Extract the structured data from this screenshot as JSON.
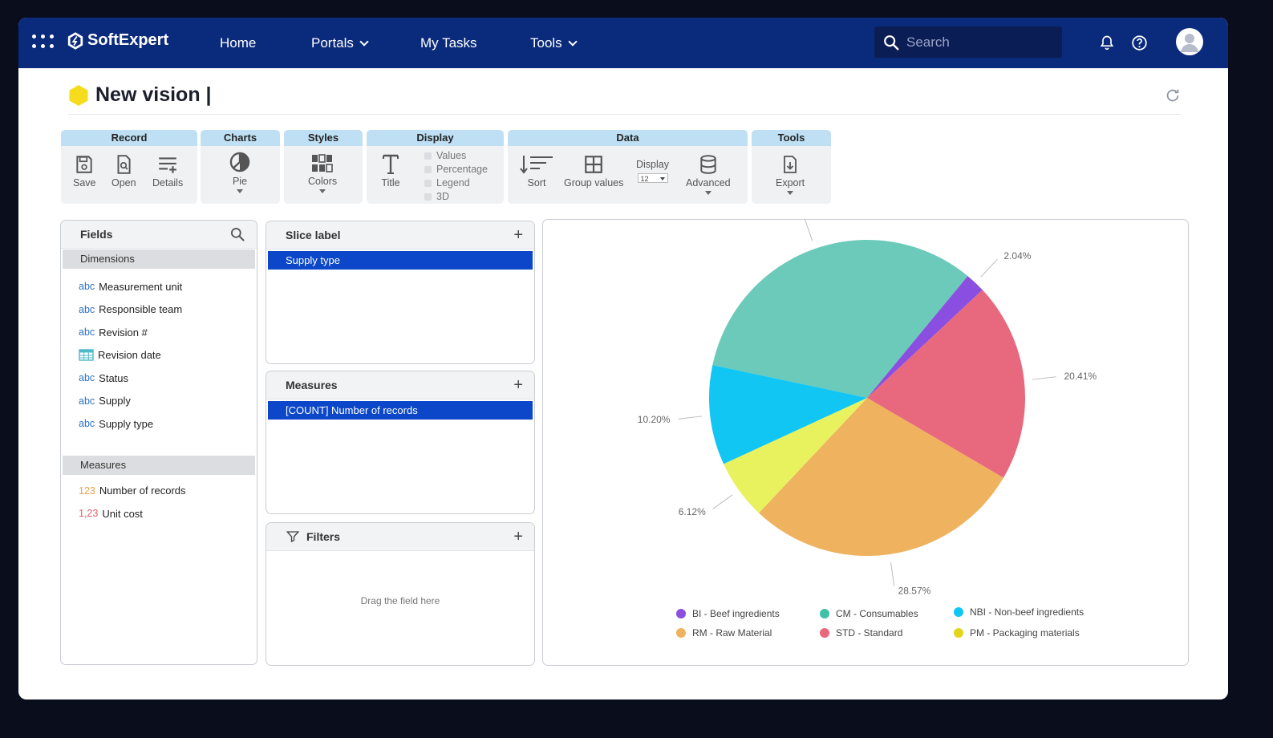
{
  "header": {
    "brand": "SoftExpert",
    "nav": [
      {
        "label": "Home",
        "has_dropdown": false
      },
      {
        "label": "Portals",
        "has_dropdown": true
      },
      {
        "label": "My Tasks",
        "has_dropdown": false
      },
      {
        "label": "Tools",
        "has_dropdown": true
      }
    ],
    "search_placeholder": "Search",
    "icons": [
      "apps-grid-icon",
      "bell-icon",
      "help-icon",
      "user-avatar-icon"
    ]
  },
  "page": {
    "title": "New vision |",
    "title_marker_color": "#f5dd1d"
  },
  "toolbar": {
    "record": {
      "title": "Record",
      "save": "Save",
      "open": "Open",
      "details": "Details"
    },
    "charts": {
      "title": "Charts",
      "pie": "Pie"
    },
    "styles": {
      "title": "Styles",
      "colors": "Colors"
    },
    "display": {
      "title": "Display",
      "title_btn": "Title",
      "values": "Values",
      "percentage": "Percentage",
      "legend": "Legend",
      "three_d": "3D"
    },
    "data": {
      "title": "Data",
      "sort": "Sort",
      "group_values": "Group values",
      "display_label": "Display",
      "display_value": "12",
      "advanced": "Advanced"
    },
    "tools": {
      "title": "Tools",
      "export": "Export"
    }
  },
  "fields_panel": {
    "title": "Fields",
    "dimensions_label": "Dimensions",
    "dimensions": [
      {
        "type": "abc",
        "label": "Measurement unit"
      },
      {
        "type": "abc",
        "label": "Responsible team"
      },
      {
        "type": "abc",
        "label": "Revision #"
      },
      {
        "type": "date",
        "label": "Revision date"
      },
      {
        "type": "abc",
        "label": "Status"
      },
      {
        "type": "abc",
        "label": "Supply"
      },
      {
        "type": "abc",
        "label": "Supply type"
      }
    ],
    "measures_label": "Measures",
    "measures": [
      {
        "type": "123",
        "label": "Number of records"
      },
      {
        "type": "1,23",
        "label": "Unit cost"
      }
    ]
  },
  "slice_panel": {
    "title": "Slice label",
    "item": "Supply type"
  },
  "measures_panel": {
    "title": "Measures",
    "item": "[COUNT] Number of records"
  },
  "filters_panel": {
    "title": "Filters",
    "placeholder": "Drag the field here"
  },
  "chart_data": {
    "type": "pie",
    "slices": [
      {
        "label": "CM - Consumables",
        "value": 32.65,
        "display": "32.65%",
        "color": "#6bcab9"
      },
      {
        "label": "BI - Beef ingredients",
        "value": 2.04,
        "display": "2.04%",
        "color": "#8a4fe0"
      },
      {
        "label": "STD - Standard",
        "value": 20.41,
        "display": "20.41%",
        "color": "#e8697d"
      },
      {
        "label": "RM - Raw Material",
        "value": 28.57,
        "display": "28.57%",
        "color": "#efb25e"
      },
      {
        "label": "PM - Packaging materials",
        "value": 6.12,
        "display": "6.12%",
        "color": "#e8f25e"
      },
      {
        "label": "NBI - Non-beef ingredients",
        "value": 10.2,
        "display": "10.20%",
        "color": "#12c6f4"
      }
    ],
    "legend": [
      {
        "label": "BI - Beef ingredients",
        "color": "#8a4fe0"
      },
      {
        "label": "CM - Consumables",
        "color": "#3fc1a9"
      },
      {
        "label": "NBI - Non-beef ingredients",
        "color": "#12c6f4"
      },
      {
        "label": "RM - Raw Material",
        "color": "#efb25e"
      },
      {
        "label": "STD - Standard",
        "color": "#e8697d"
      },
      {
        "label": "PM - Packaging materials",
        "color": "#e3d51e"
      }
    ],
    "legend_position": "bottom"
  }
}
